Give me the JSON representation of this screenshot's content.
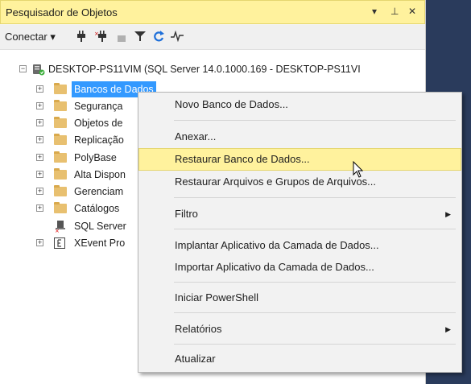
{
  "panel": {
    "title": "Pesquisador de Objetos",
    "pin_glyph": "▾  ⊥  ✕"
  },
  "toolbar": {
    "connect_label": "Conectar ▾"
  },
  "tree": {
    "server": "DESKTOP-PS11VIM (SQL Server 14.0.1000.169 - DESKTOP-PS11VI",
    "items": [
      {
        "label": "Bancos de Dados"
      },
      {
        "label": "Segurança"
      },
      {
        "label": "Objetos de"
      },
      {
        "label": "Replicação"
      },
      {
        "label": "PolyBase"
      },
      {
        "label": "Alta Dispon"
      },
      {
        "label": "Gerenciam"
      },
      {
        "label": "Catálogos"
      },
      {
        "label": "SQL Server"
      },
      {
        "label": "XEvent Pro"
      }
    ]
  },
  "context_menu": {
    "items": [
      {
        "label": "Novo Banco de Dados..."
      },
      {
        "label": "Anexar..."
      },
      {
        "label": "Restaurar Banco de Dados..."
      },
      {
        "label": "Restaurar Arquivos e Grupos de Arquivos..."
      },
      {
        "label": "Filtro"
      },
      {
        "label": "Implantar Aplicativo da Camada de Dados..."
      },
      {
        "label": "Importar Aplicativo da Camada de Dados..."
      },
      {
        "label": "Iniciar PowerShell"
      },
      {
        "label": "Relatórios"
      },
      {
        "label": "Atualizar"
      }
    ]
  },
  "colors": {
    "highlight": "#fff29d",
    "selection": "#3399ff",
    "background": "#2a3b5c"
  }
}
